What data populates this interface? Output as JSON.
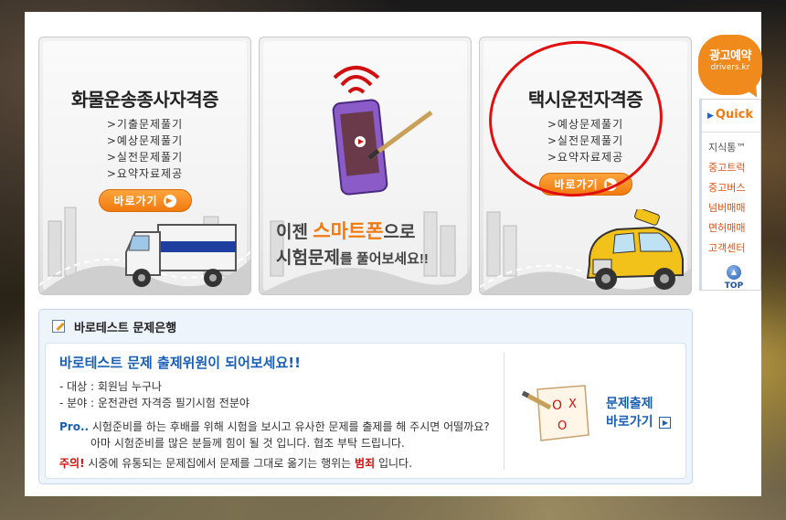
{
  "cards": [
    {
      "title": "화물운송종사자격증",
      "items": [
        ">기출문제풀기",
        ">예상문제풀기",
        ">실전문제풀기",
        ">요약자료제공"
      ],
      "button": "바로가기"
    },
    {
      "line1_a": "이젠 ",
      "line1_hl": "스마트폰",
      "line1_b": "으로",
      "line2_a": "시험문제",
      "line2_b": "를 풀어보세요!!"
    },
    {
      "title": "택시운전자격증",
      "items": [
        ">예상문제풀기",
        ">실전문제풀기",
        ">요약자료제공"
      ],
      "button": "바로가기"
    }
  ],
  "sidebar": {
    "ad_line1": "광고예약",
    "ad_line2": "drivers.kr",
    "quick_label": "Quick",
    "items": [
      "지식통™",
      "중고트럭",
      "중고버스",
      "넘버매매",
      "면허매매",
      "고객센터"
    ],
    "top_label": "TOP"
  },
  "bank": {
    "header": "바로테스트 문제은행",
    "title": "바로테스트 문제 출제위원이 되어보세요!!",
    "target": "- 대상 : 회원님 누구나",
    "field": "- 분야 : 운전관련 자격증 필기시험 전분야",
    "pro_label": "Pro..",
    "pro_text1": " 시험준비를 하는 후배를 위해 시험을 보시고 유사한 문제를 출제를 해 주시면 어떨까요?",
    "pro_text2": "아마 시험준비를 많은 분들께 힘이 될 것 입니다. 협조 부탁 드립니다.",
    "warn_label": "주의!",
    "warn_text_a": " 시중에 유통되는 문제집에서 문제를 그대로 옮기는 행위는 ",
    "warn_crime": "범죄",
    "warn_text_b": " 입니다.",
    "link_line1": "문제출제",
    "link_line2": "바로가기"
  },
  "colors": {
    "accent_orange": "#f07a10",
    "link_blue": "#1a5fb4",
    "highlight_red": "#e01010"
  }
}
